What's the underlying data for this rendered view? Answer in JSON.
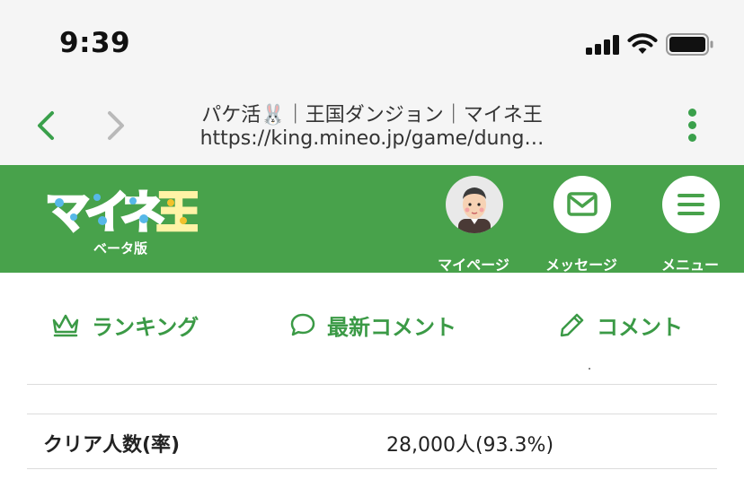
{
  "status_bar": {
    "time": "9:39"
  },
  "browser": {
    "page_title": "パケ活🐰｜王国ダンジョン｜マイネ王",
    "url": "https://king.mineo.jp/game/dung…"
  },
  "header": {
    "logo_text": "マイネ王",
    "beta_label": "ベータ版",
    "buttons": [
      {
        "label": "マイページ",
        "icon": "avatar-icon"
      },
      {
        "label": "メッセージ",
        "icon": "envelope-icon"
      },
      {
        "label": "メニュー",
        "icon": "hamburger-icon"
      }
    ]
  },
  "subnav": {
    "items": [
      {
        "label": "ランキング",
        "icon": "crown-icon"
      },
      {
        "label": "最新コメント",
        "icon": "speech-bubble-icon"
      },
      {
        "label": "コメント",
        "icon": "pencil-icon"
      }
    ]
  },
  "stats": {
    "clear_label": "クリア人数(率)",
    "clear_value": "28,000人(93.3%)"
  },
  "colors": {
    "brand_green": "#48a24b",
    "link_green": "#3b9a46",
    "chrome_bg": "#f5f5f5"
  }
}
